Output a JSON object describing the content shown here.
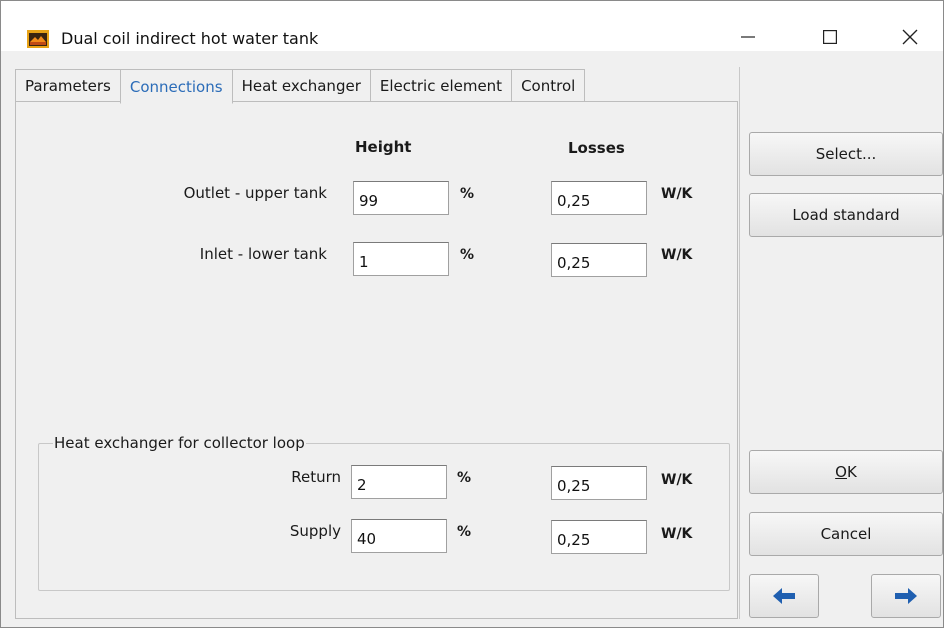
{
  "window": {
    "title": "Dual coil indirect hot water tank",
    "controls": {
      "minimize_icon": "minimize-icon",
      "maximize_icon": "maximize-icon",
      "close_icon": "close-icon"
    }
  },
  "tabs": [
    {
      "label": "Parameters",
      "active": false
    },
    {
      "label": "Connections",
      "active": true
    },
    {
      "label": "Heat exchanger",
      "active": false
    },
    {
      "label": "Electric element",
      "active": false
    },
    {
      "label": "Control",
      "active": false
    }
  ],
  "connections": {
    "height_header": "Height",
    "losses_header": "Losses",
    "rows": [
      {
        "label": "Outlet - upper tank",
        "height": "99",
        "height_unit": "%",
        "losses": "0,25",
        "losses_unit": "W/K"
      },
      {
        "label": "Inlet - lower tank",
        "height": "1",
        "height_unit": "%",
        "losses": "0,25",
        "losses_unit": "W/K"
      }
    ],
    "collector_group": {
      "title": "Heat exchanger for collector loop",
      "rows": [
        {
          "label": "Return",
          "height": "2",
          "height_unit": "%",
          "losses": "0,25",
          "losses_unit": "W/K"
        },
        {
          "label": "Supply",
          "height": "40",
          "height_unit": "%",
          "losses": "0,25",
          "losses_unit": "W/K"
        }
      ]
    }
  },
  "side_buttons": {
    "select": "Select...",
    "load_standard": "Load standard",
    "ok_prefix": "O",
    "ok_rest": "K",
    "cancel": "Cancel",
    "back_icon": "arrow-left-icon",
    "forward_icon": "arrow-right-icon"
  },
  "colors": {
    "active_tab_text": "#2b6cb8",
    "arrow_blue": "#1f5fb0",
    "dialog_background": "#f0f0f0"
  }
}
